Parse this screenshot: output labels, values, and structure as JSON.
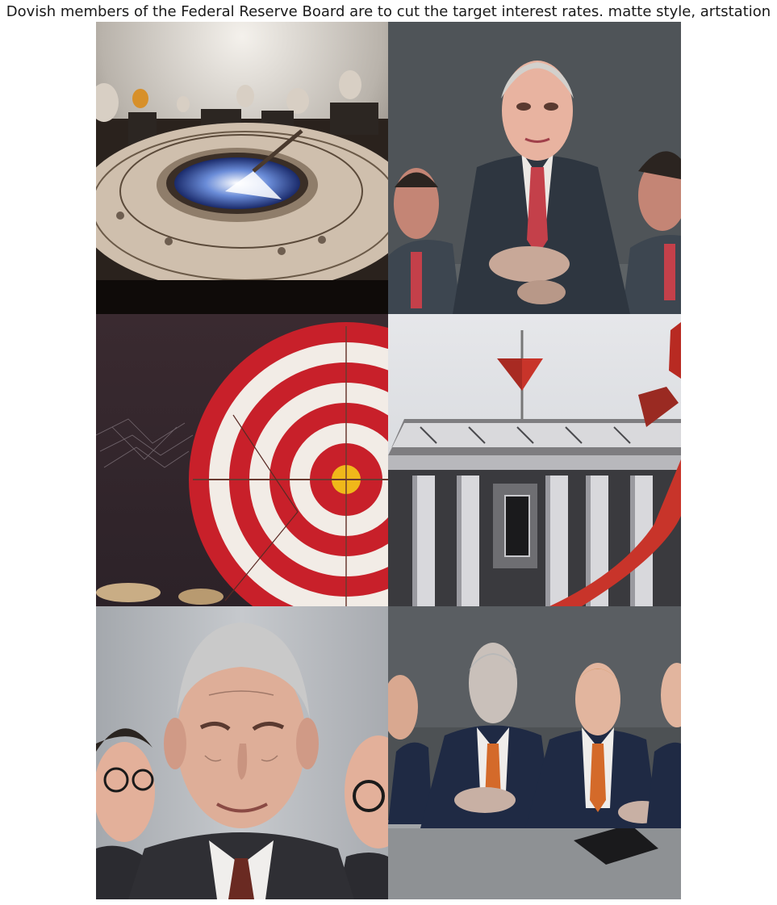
{
  "figure": {
    "title": "Dovish members of the Federal Reserve Board are to cut the target interest rates. matte style, artstation"
  },
  "panels": [
    {
      "subject": "round-table-meeting"
    },
    {
      "subject": "board-members-portrait"
    },
    {
      "subject": "red-white-target"
    },
    {
      "subject": "federal-reserve-building"
    },
    {
      "subject": "chairman-closeup-portrait"
    },
    {
      "subject": "board-members-at-table"
    }
  ],
  "colors": {
    "suit_dark": "#2e3640",
    "suit_navy": "#1f2a44",
    "tie_red": "#c4404a",
    "tie_orange": "#d46a2a",
    "target_red": "#c8202a",
    "target_white": "#f2ece6",
    "bullseye": "#f0b81a",
    "skin": "#e8b8a0",
    "hair_gray": "#c9c9c9"
  }
}
